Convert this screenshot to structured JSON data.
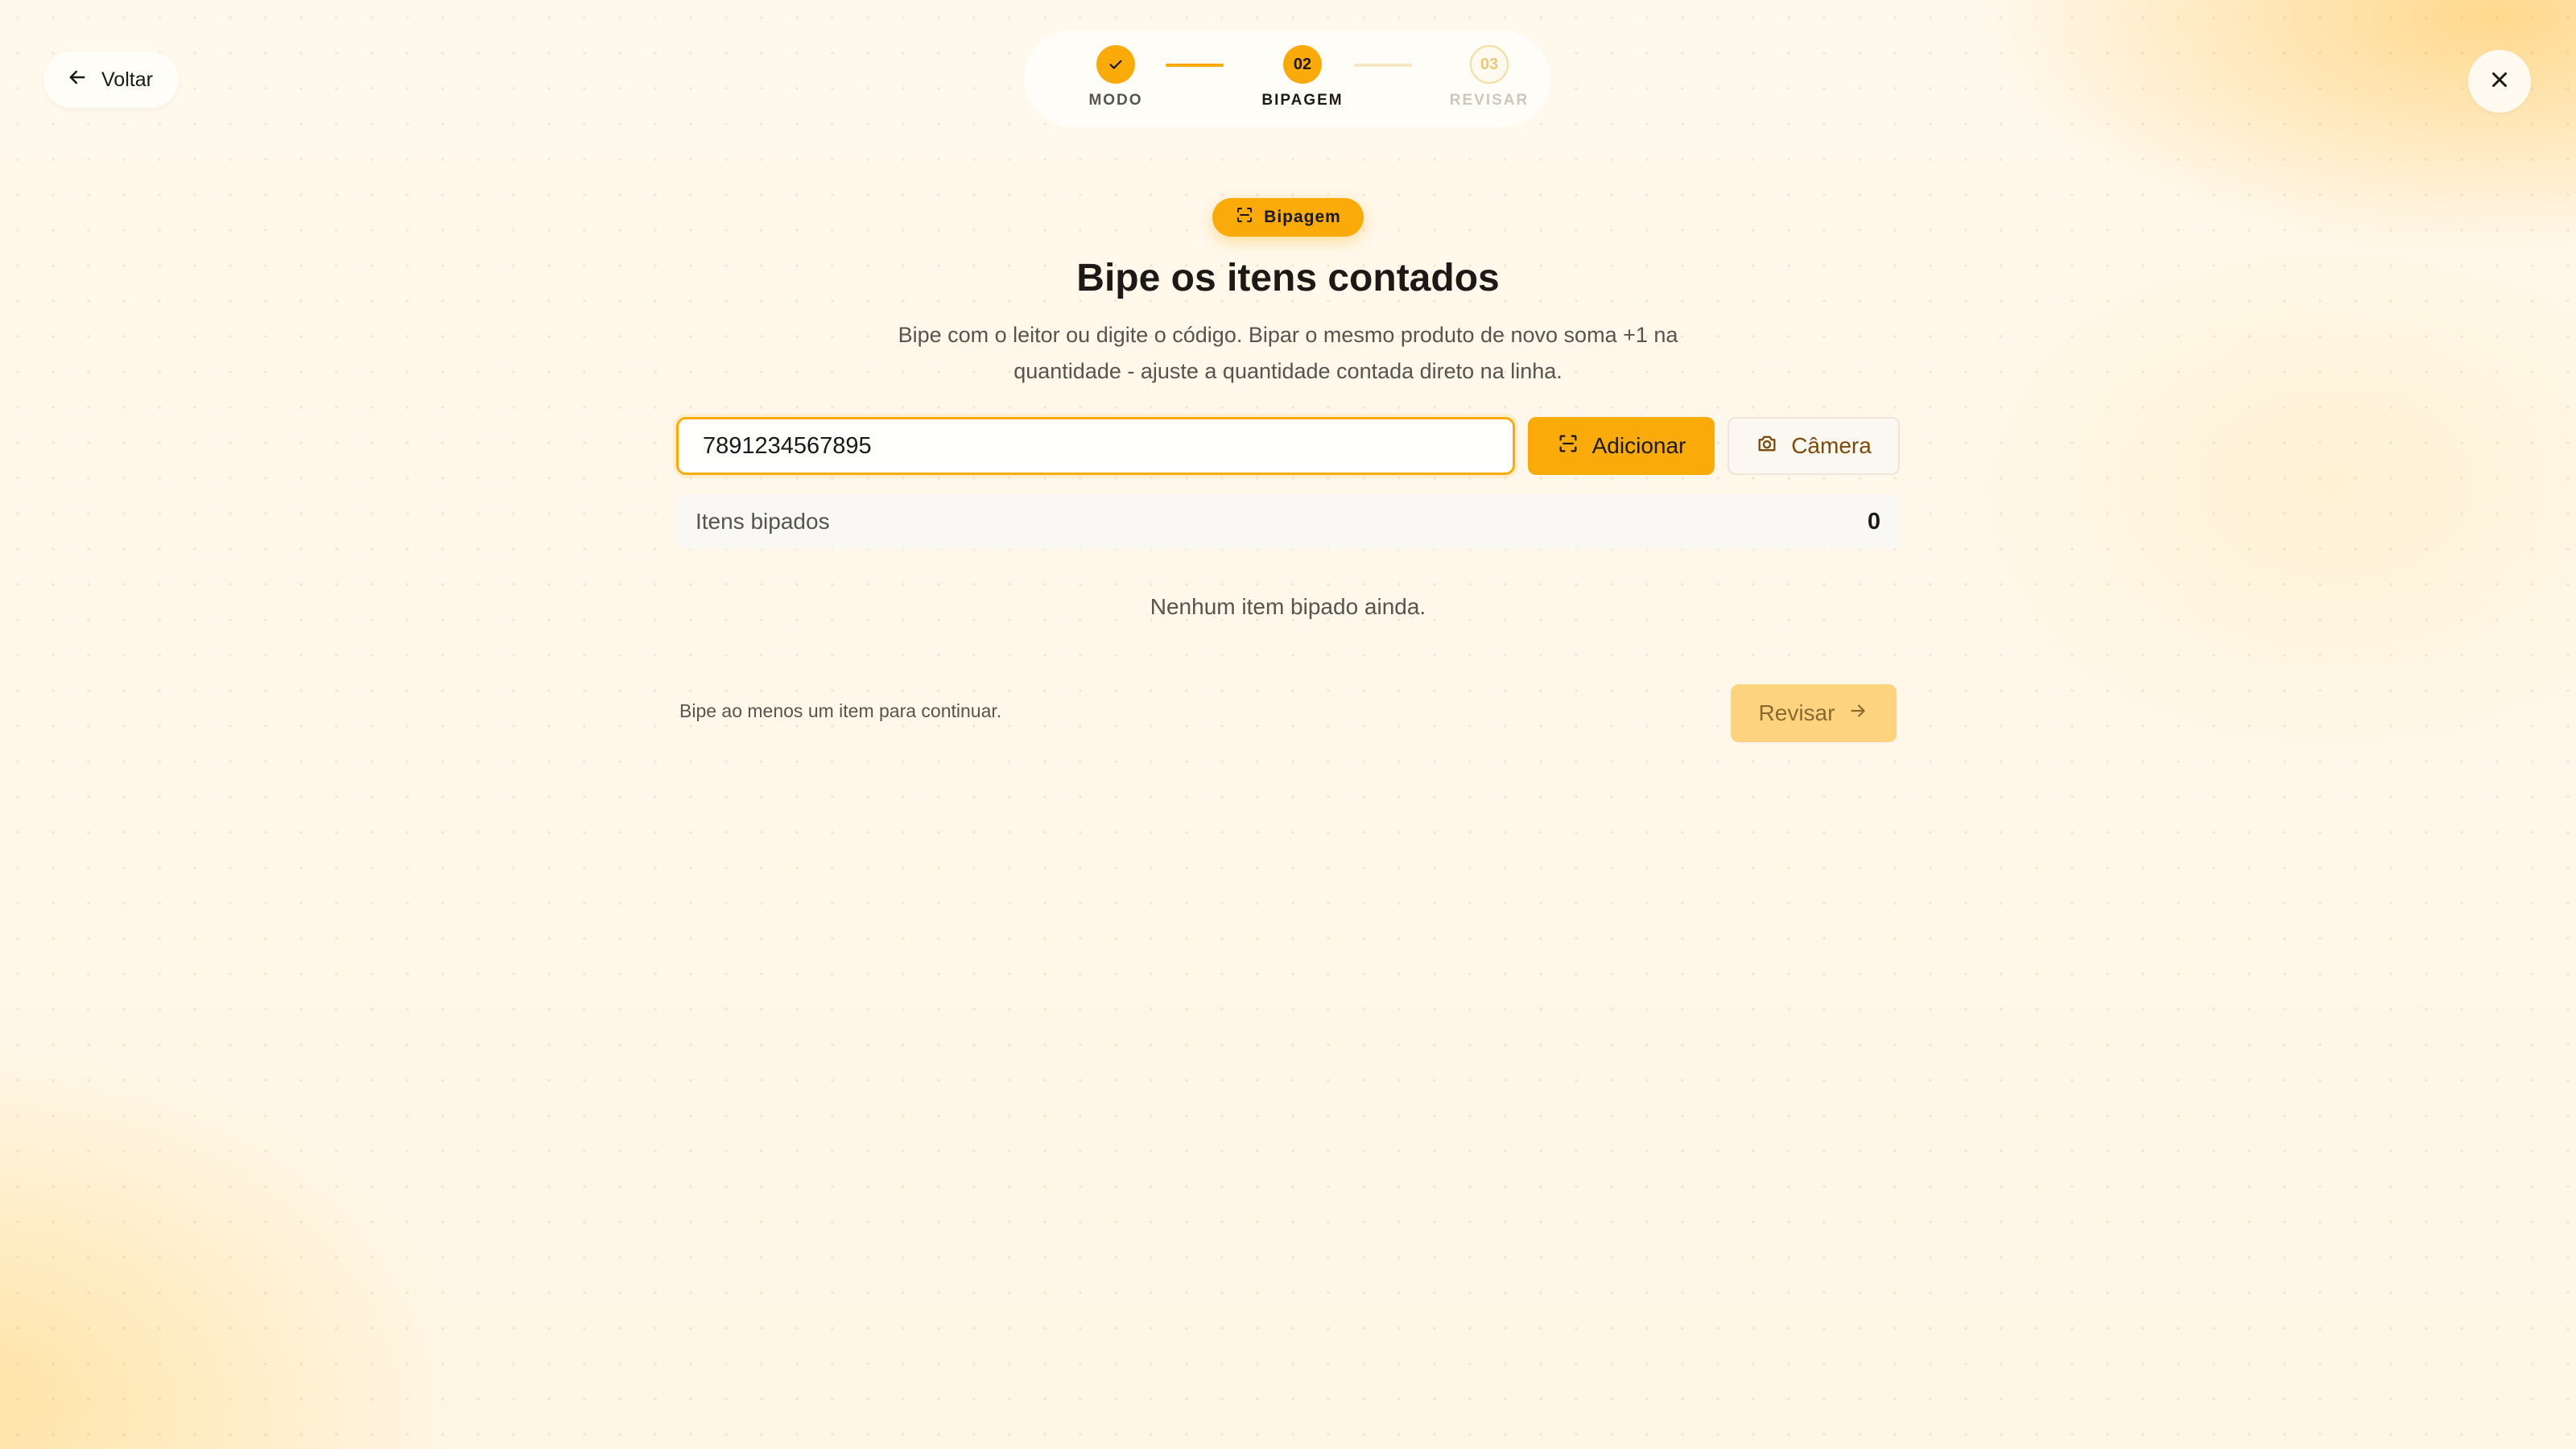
{
  "nav": {
    "back_label": "Voltar"
  },
  "stepper": {
    "steps": [
      {
        "number": "",
        "label": "MODO",
        "state": "done"
      },
      {
        "number": "02",
        "label": "BIPAGEM",
        "state": "active"
      },
      {
        "number": "03",
        "label": "REVISAR",
        "state": "todo"
      }
    ]
  },
  "badge": {
    "label": "Bipagem"
  },
  "header": {
    "title": "Bipe os itens contados",
    "subtitle": "Bipe com o leitor ou digite o código. Bipar o mesmo produto de novo soma +1 na quantidade - ajuste a quantidade contada direto na linha."
  },
  "scan": {
    "value": "7891234567895",
    "add_label": "Adicionar",
    "camera_label": "Câmera"
  },
  "summary": {
    "label": "Itens bipados",
    "count": "0"
  },
  "empty_state": "Nenhum item bipado ainda.",
  "footer": {
    "hint": "Bipe ao menos um item para continuar.",
    "review_label": "Revisar"
  },
  "colors": {
    "accent": "#fbab09",
    "accent_disabled": "#fdd37f",
    "text": "#1c1917",
    "muted": "#57534e"
  }
}
